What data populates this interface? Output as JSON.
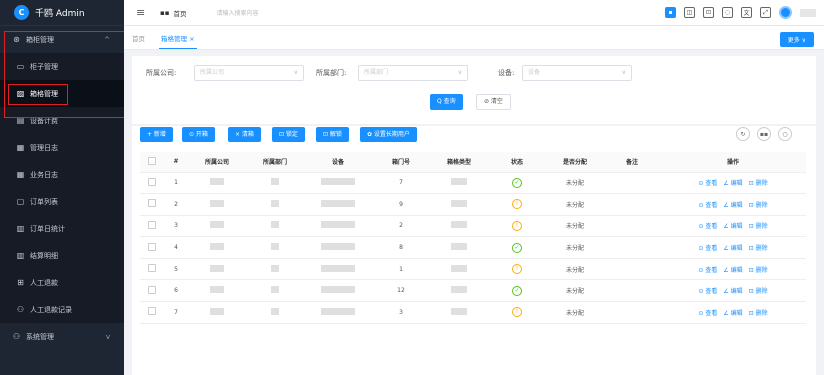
{
  "app": {
    "title": "千鸥 Admin",
    "logo_letter": "C"
  },
  "sidebar": {
    "items": [
      {
        "label": "箱柜管理",
        "icon": "cabinet-icon",
        "glyph": "⊛",
        "chevron": "^",
        "active": false,
        "sub": false
      },
      {
        "label": "柜子管理",
        "icon": "monitor-icon",
        "glyph": "▭",
        "chevron": "",
        "active": false,
        "sub": true
      },
      {
        "label": "箱格管理",
        "icon": "picture-icon",
        "glyph": "▨",
        "chevron": "",
        "active": true,
        "sub": true
      },
      {
        "label": "设备计费",
        "icon": "calendar-icon",
        "glyph": "▤",
        "chevron": "",
        "active": false,
        "sub": true
      },
      {
        "label": "管理日志",
        "icon": "log-icon",
        "glyph": "▦",
        "chevron": "",
        "active": false,
        "sub": true
      },
      {
        "label": "业务日志",
        "icon": "log-icon",
        "glyph": "▦",
        "chevron": "",
        "active": false,
        "sub": true
      },
      {
        "label": "订单列表",
        "icon": "list-icon",
        "glyph": "▢",
        "chevron": "",
        "active": false,
        "sub": true
      },
      {
        "label": "订单日统计",
        "icon": "stats-icon",
        "glyph": "▥",
        "chevron": "",
        "active": false,
        "sub": true
      },
      {
        "label": "结算明细",
        "icon": "detail-icon",
        "glyph": "▥",
        "chevron": "",
        "active": false,
        "sub": true
      },
      {
        "label": "人工退款",
        "icon": "grid-icon",
        "glyph": "⊞",
        "chevron": "",
        "active": false,
        "sub": true
      },
      {
        "label": "人工退款记录",
        "icon": "users-icon",
        "glyph": "⚇",
        "chevron": "",
        "active": false,
        "sub": true
      },
      {
        "label": "系统管理",
        "icon": "system-icon",
        "glyph": "⚇",
        "chevron": "v",
        "active": false,
        "sub": false
      }
    ]
  },
  "header": {
    "breadcrumb": "首页",
    "search_placeholder": "请输入搜索内容"
  },
  "tabs": [
    {
      "label": "首页",
      "active": false
    },
    {
      "label": "箱格管理 ×",
      "active": true
    }
  ],
  "more_label": "更多 ∨",
  "filter": {
    "company_label": "所属公司:",
    "company_placeholder": "所属公司",
    "dept_label": "所属部门:",
    "dept_placeholder": "所属部门",
    "device_label": "设备:",
    "device_placeholder": "设备",
    "query_label": "Q 查询",
    "clear_label": "⊘ 清空"
  },
  "actions": [
    "+ 新增",
    "⊙ 开箱",
    "× 清箱",
    "⊡ 锁定",
    "⊡ 解锁",
    "✿ 设置长期用户"
  ],
  "table": {
    "headers": [
      "",
      "#",
      "所属公司",
      "所属部门",
      "设备",
      "箱门号",
      "箱格类型",
      "状态",
      "是否分配",
      "备注",
      "操作"
    ],
    "rows": [
      {
        "index": "1",
        "door": "7",
        "status": "ok",
        "assigned": "未分配"
      },
      {
        "index": "2",
        "door": "9",
        "status": "warn",
        "assigned": "未分配"
      },
      {
        "index": "3",
        "door": "2",
        "status": "warn",
        "assigned": "未分配"
      },
      {
        "index": "4",
        "door": "8",
        "status": "ok",
        "assigned": "未分配"
      },
      {
        "index": "5",
        "door": "1",
        "status": "warn",
        "assigned": "未分配"
      },
      {
        "index": "6",
        "door": "12",
        "status": "ok",
        "assigned": "未分配"
      },
      {
        "index": "7",
        "door": "3",
        "status": "warn",
        "assigned": "未分配"
      }
    ],
    "op_view": "⊙ 查看",
    "op_edit": "∠ 编辑",
    "op_delete": "⊡ 删除"
  },
  "colors": {
    "accent": "#1890ff",
    "ok": "#52c41a",
    "warn": "#faad14",
    "highlight": "#e02020"
  }
}
